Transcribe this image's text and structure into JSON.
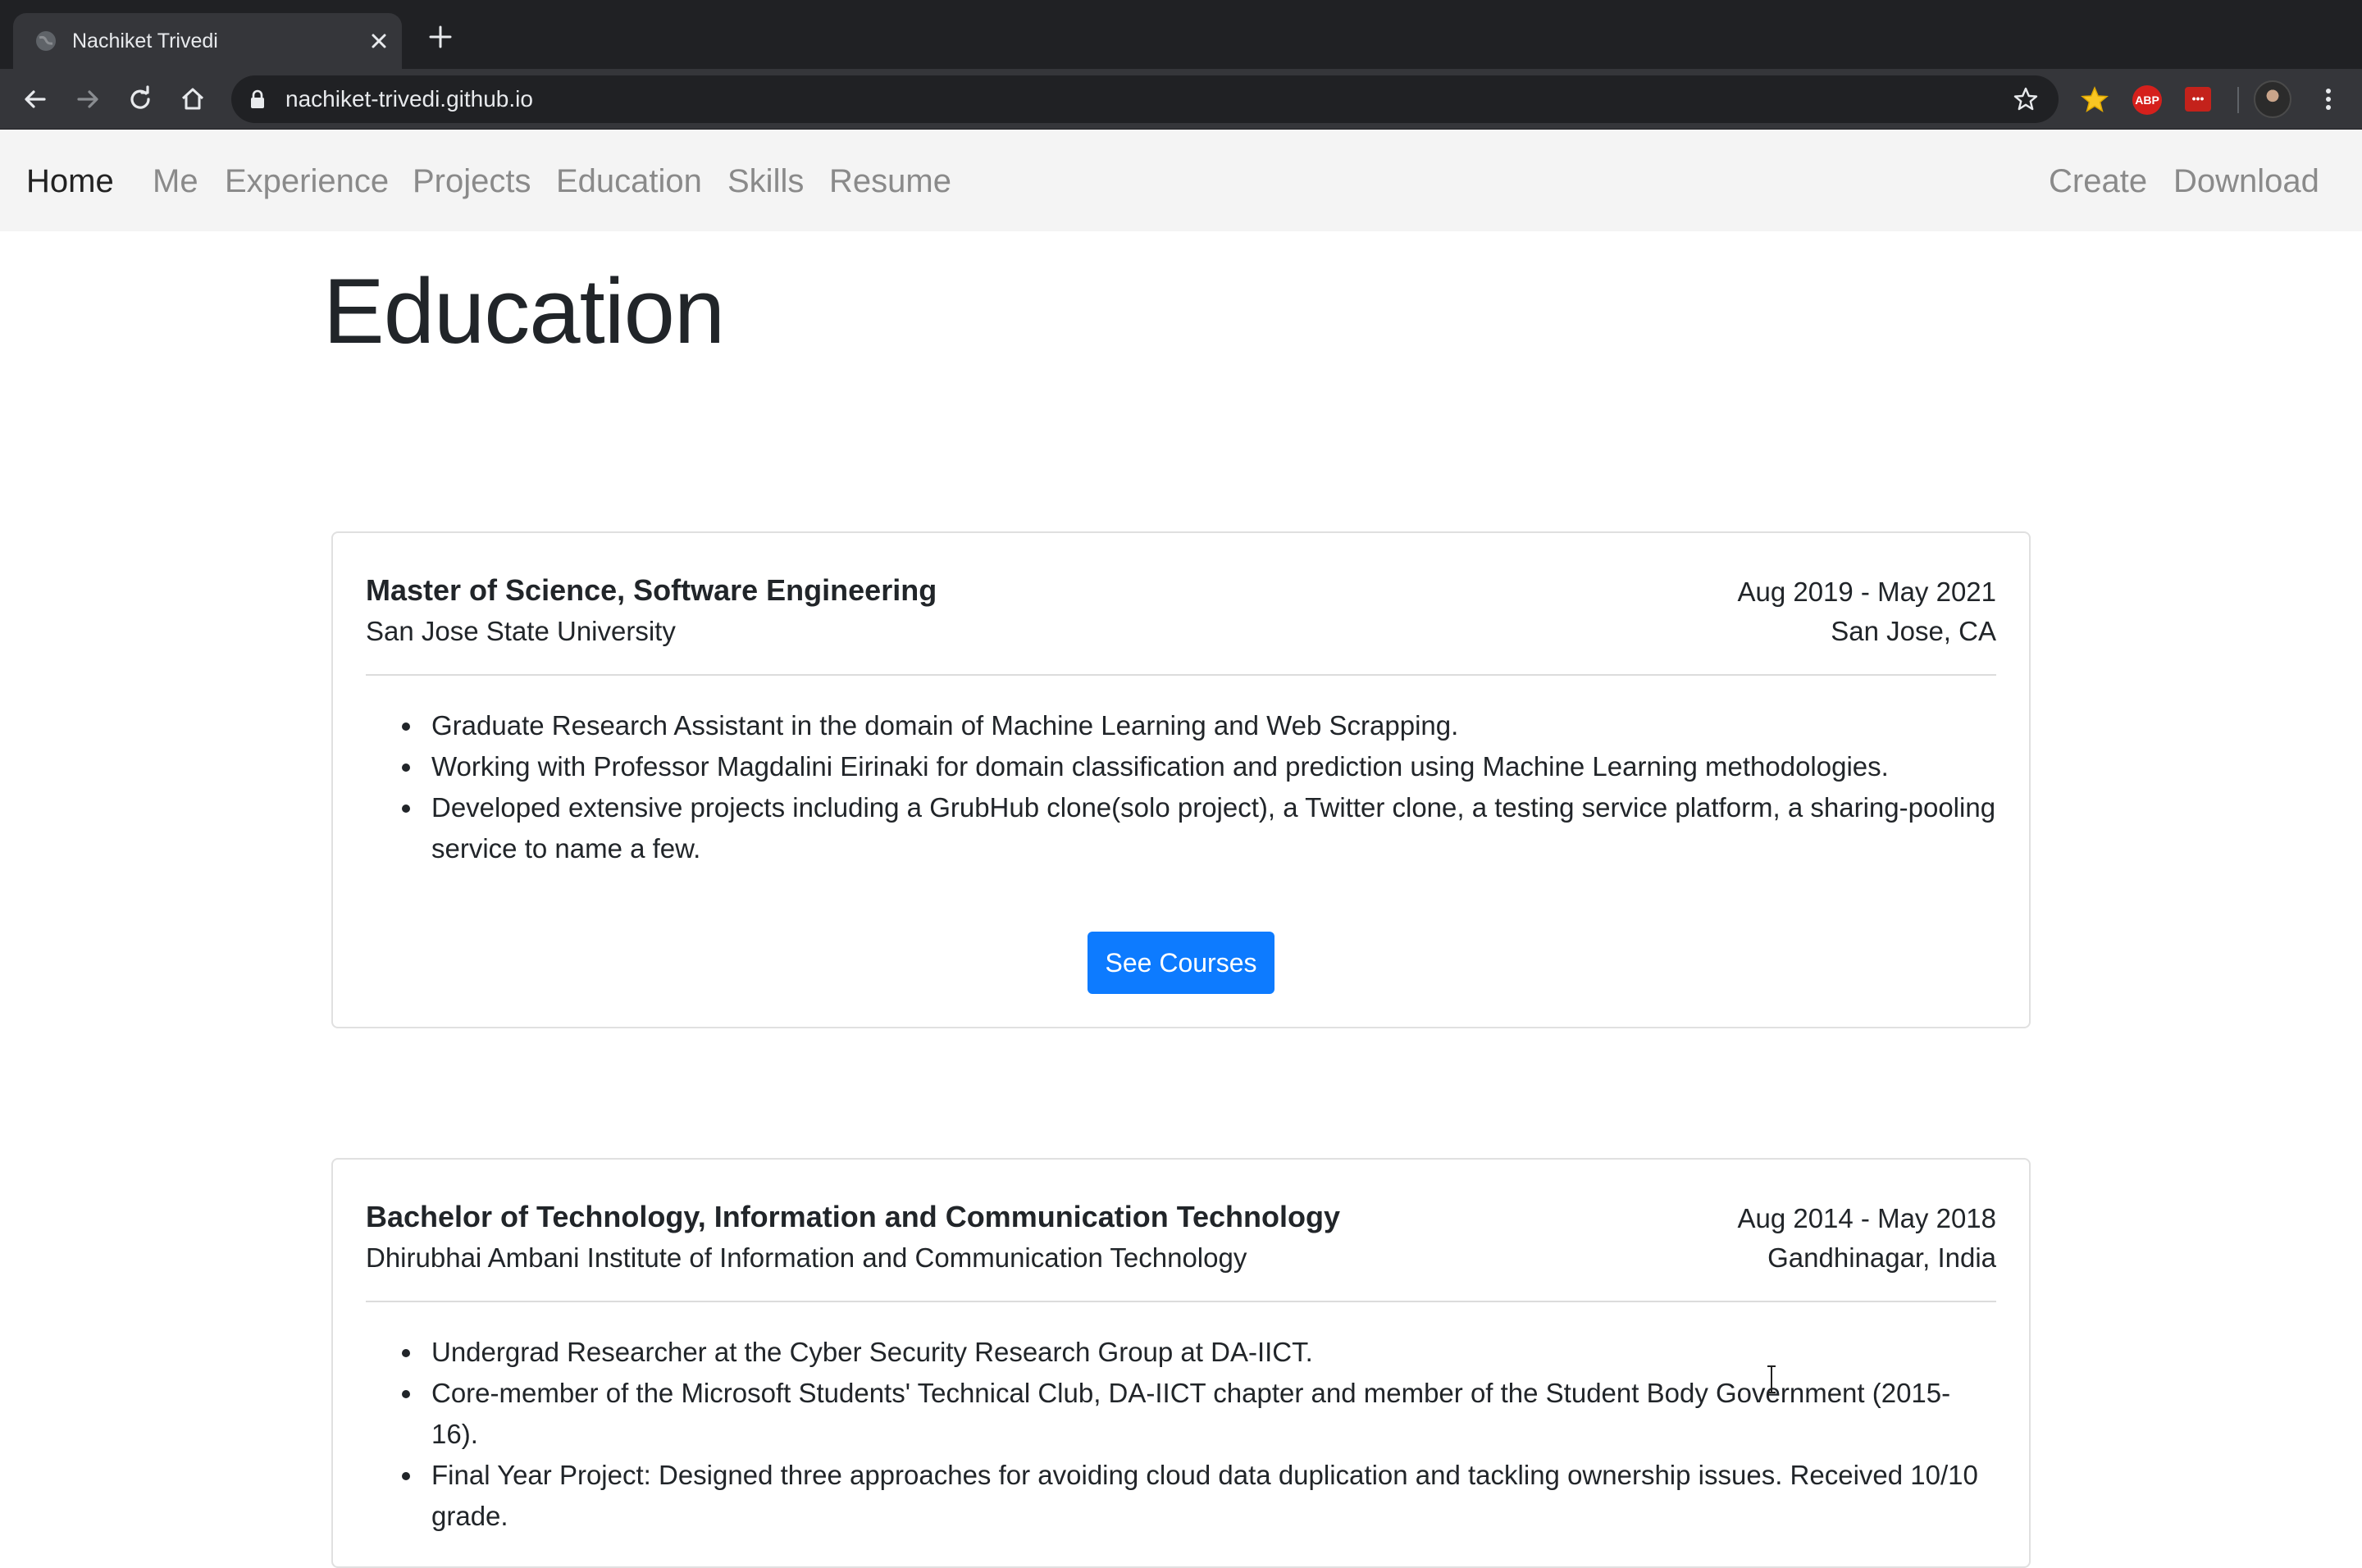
{
  "browser": {
    "tab_title": "Nachiket Trivedi",
    "url": "nachiket-trivedi.github.io",
    "extensions": {
      "abp_label": "ABP",
      "red_ext_label": "•••"
    }
  },
  "nav": {
    "brand": "Home",
    "left_items": [
      "Me",
      "Experience",
      "Projects",
      "Education",
      "Skills",
      "Resume"
    ],
    "right_items": [
      "Create",
      "Download"
    ]
  },
  "page": {
    "title": "Education"
  },
  "education": [
    {
      "degree": "Master of Science, Software Engineering",
      "school": "San Jose State University",
      "dates": "Aug 2019 - May 2021",
      "location": "San Jose, CA",
      "bullets": [
        "Graduate Research Assistant in the domain of Machine Learning and Web Scrapping.",
        "Working with Professor Magdalini Eirinaki for domain classification and prediction using Machine Learning methodologies.",
        "Developed extensive projects including a GrubHub clone(solo project), a Twitter clone, a testing service platform, a sharing-pooling service to name a few."
      ],
      "button_label": "See Courses"
    },
    {
      "degree": "Bachelor of Technology, Information and Communication Technology",
      "school": "Dhirubhai Ambani Institute of Information and Communication Technology",
      "dates": "Aug 2014 - May 2018",
      "location": "Gandhinagar, India",
      "bullets": [
        "Undergrad Researcher at the Cyber Security Research Group at DA-IICT.",
        "Core-member of the Microsoft Students' Technical Club, DA-IICT chapter and member of the Student Body Government (2015-16).",
        "Final Year Project: Designed three approaches for avoiding cloud data duplication and tackling ownership issues. Received 10/10 grade."
      ]
    }
  ],
  "colors": {
    "button_primary": "#0d7bff",
    "chrome_dark": "#202124",
    "navbar_bg": "#f4f4f4"
  }
}
